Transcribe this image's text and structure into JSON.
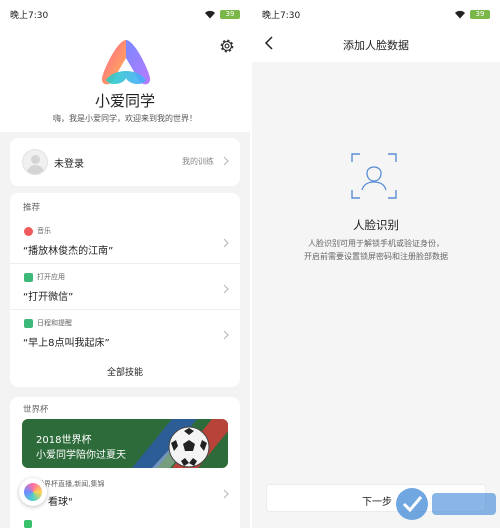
{
  "left": {
    "status": {
      "time": "晚上7:30",
      "battery": "39"
    },
    "app_title": "小爱同学",
    "app_subtitle": "嗨，我是小爱同学，欢迎来到我的世界！",
    "login": {
      "label": "未登录",
      "training": "我的训练"
    },
    "recommend": {
      "title": "推荐",
      "items": [
        {
          "tag": "音乐",
          "text": "“播放林俊杰的江南”",
          "color": "#f05a5a"
        },
        {
          "tag": "打开应用",
          "text": "“打开微信”",
          "color": "#3cb878"
        },
        {
          "tag": "日程和提醒",
          "text": "“早上8点叫我起床”",
          "color": "#3cb878"
        }
      ],
      "all_skills": "全部技能"
    },
    "worldcup": {
      "title": "世界杯",
      "banner_line1": "2018世界杯",
      "banner_line2": "小爱同学陪你过夏天",
      "item_tag": "世界杯直播,新闻,集锦",
      "item_text": "看球\""
    }
  },
  "right": {
    "status": {
      "time": "晚上7:30",
      "battery": "39"
    },
    "title": "添加人脸数据",
    "face_title": "人脸识别",
    "desc_line1": "人脸识别可用于解锁手机或验证身份，",
    "desc_line2": "开启前需要设置锁屏密码和注册脸部数据",
    "next_button": "下一步"
  },
  "icons": {
    "gear": "gear-icon",
    "back": "back-arrow-icon",
    "face": "face-scan-icon",
    "chevron": "chevron-right-icon"
  },
  "colors": {
    "accent_green": "#7ab648",
    "banner_green": "#2e6b3a"
  }
}
